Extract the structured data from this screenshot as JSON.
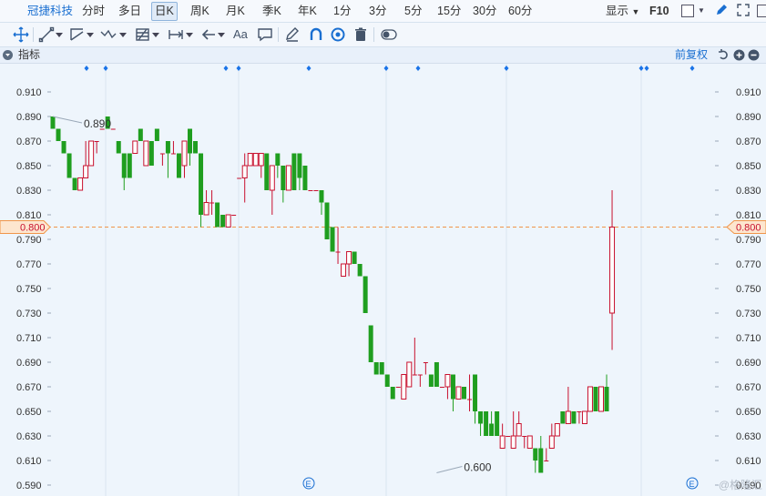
{
  "header": {
    "stock_name": "冠捷科技",
    "periods": [
      "分时",
      "多日",
      "日K",
      "周K",
      "月K",
      "季K",
      "年K",
      "1分",
      "3分",
      "5分",
      "15分",
      "30分",
      "60分"
    ],
    "active_period": "日K",
    "display_label": "显示",
    "f10_label": "F10"
  },
  "toolbar": {
    "text_tool_label": "Aa"
  },
  "indicator_bar": {
    "label": "指标",
    "adjust_label": "前复权"
  },
  "colors": {
    "up": "#c8102e",
    "down": "#1f9e1f",
    "accent": "#1a6fd1",
    "price_line": "#f0954a"
  },
  "chart_data": {
    "type": "candlestick",
    "ylim": [
      0.585,
      0.915
    ],
    "y_ticks": [
      "0.910",
      "0.890",
      "0.870",
      "0.850",
      "0.830",
      "0.810",
      "0.790",
      "0.770",
      "0.750",
      "0.730",
      "0.710",
      "0.690",
      "0.670",
      "0.650",
      "0.630",
      "0.610",
      "0.590"
    ],
    "current_price": "0.800",
    "annotations": [
      {
        "label": "0.890",
        "index": 0,
        "value": 0.89
      },
      {
        "label": "0.600",
        "index": 70,
        "value": 0.6
      }
    ],
    "event_badge": "E",
    "candles": [
      [
        0.89,
        0.88,
        0.89,
        0.88
      ],
      [
        0.88,
        0.87,
        0.88,
        0.87
      ],
      [
        0.87,
        0.86,
        0.87,
        0.86
      ],
      [
        0.86,
        0.84,
        0.86,
        0.84
      ],
      [
        0.84,
        0.83,
        0.84,
        0.83
      ],
      [
        0.83,
        0.84,
        0.84,
        0.83
      ],
      [
        0.84,
        0.85,
        0.87,
        0.84
      ],
      [
        0.85,
        0.87,
        0.87,
        0.85
      ],
      [
        0.87,
        0.87,
        0.87,
        0.86
      ],
      [
        0.88,
        0.88,
        0.88,
        0.88
      ],
      [
        0.89,
        0.88,
        0.89,
        0.88
      ],
      [
        0.88,
        0.88,
        0.88,
        0.88
      ],
      [
        0.87,
        0.86,
        0.87,
        0.86
      ],
      [
        0.86,
        0.84,
        0.86,
        0.83
      ],
      [
        0.86,
        0.84,
        0.86,
        0.84
      ],
      [
        0.86,
        0.87,
        0.87,
        0.86
      ],
      [
        0.88,
        0.87,
        0.88,
        0.87
      ],
      [
        0.85,
        0.87,
        0.87,
        0.85
      ],
      [
        0.87,
        0.85,
        0.87,
        0.85
      ],
      [
        0.88,
        0.87,
        0.88,
        0.87
      ],
      [
        0.86,
        0.86,
        0.86,
        0.85
      ],
      [
        0.87,
        0.86,
        0.87,
        0.84
      ],
      [
        0.86,
        0.86,
        0.87,
        0.86
      ],
      [
        0.86,
        0.84,
        0.86,
        0.84
      ],
      [
        0.85,
        0.87,
        0.87,
        0.84
      ],
      [
        0.88,
        0.86,
        0.88,
        0.85
      ],
      [
        0.87,
        0.86,
        0.87,
        0.86
      ],
      [
        0.86,
        0.81,
        0.86,
        0.8
      ],
      [
        0.81,
        0.82,
        0.83,
        0.81
      ],
      [
        0.82,
        0.82,
        0.83,
        0.81
      ],
      [
        0.82,
        0.8,
        0.82,
        0.8
      ],
      [
        0.81,
        0.8,
        0.81,
        0.8
      ],
      [
        0.8,
        0.81,
        0.81,
        0.8
      ],
      [
        0.81,
        0.81,
        0.81,
        0.81
      ],
      [
        0.84,
        0.84,
        0.84,
        0.84
      ],
      [
        0.84,
        0.85,
        0.86,
        0.82
      ],
      [
        0.85,
        0.86,
        0.86,
        0.85
      ],
      [
        0.85,
        0.86,
        0.86,
        0.85
      ],
      [
        0.85,
        0.86,
        0.86,
        0.84
      ],
      [
        0.86,
        0.83,
        0.86,
        0.83
      ],
      [
        0.83,
        0.85,
        0.85,
        0.81
      ],
      [
        0.86,
        0.85,
        0.86,
        0.84
      ],
      [
        0.85,
        0.83,
        0.85,
        0.82
      ],
      [
        0.83,
        0.85,
        0.85,
        0.83
      ],
      [
        0.86,
        0.83,
        0.86,
        0.83
      ],
      [
        0.86,
        0.84,
        0.86,
        0.83
      ],
      [
        0.85,
        0.83,
        0.85,
        0.83
      ],
      [
        0.83,
        0.83,
        0.83,
        0.83
      ],
      [
        0.83,
        0.83,
        0.83,
        0.83
      ],
      [
        0.83,
        0.82,
        0.83,
        0.81
      ],
      [
        0.82,
        0.79,
        0.82,
        0.79
      ],
      [
        0.8,
        0.78,
        0.8,
        0.78
      ],
      [
        0.78,
        0.78,
        0.8,
        0.77
      ],
      [
        0.76,
        0.77,
        0.77,
        0.76
      ],
      [
        0.77,
        0.78,
        0.78,
        0.76
      ],
      [
        0.78,
        0.77,
        0.78,
        0.77
      ],
      [
        0.77,
        0.76,
        0.77,
        0.76
      ],
      [
        0.76,
        0.73,
        0.76,
        0.73
      ],
      [
        0.72,
        0.69,
        0.72,
        0.69
      ],
      [
        0.69,
        0.68,
        0.69,
        0.68
      ],
      [
        0.69,
        0.68,
        0.69,
        0.68
      ],
      [
        0.68,
        0.67,
        0.68,
        0.67
      ],
      [
        0.67,
        0.66,
        0.67,
        0.66
      ],
      [
        0.67,
        0.67,
        0.67,
        0.67
      ],
      [
        0.66,
        0.68,
        0.68,
        0.66
      ],
      [
        0.67,
        0.69,
        0.69,
        0.67
      ],
      [
        0.68,
        0.68,
        0.71,
        0.68
      ],
      [
        0.68,
        0.68,
        0.68,
        0.67
      ],
      [
        0.69,
        0.69,
        0.69,
        0.68
      ],
      [
        0.68,
        0.67,
        0.68,
        0.67
      ],
      [
        0.69,
        0.67,
        0.69,
        0.67
      ],
      [
        0.67,
        0.67,
        0.67,
        0.67
      ],
      [
        0.67,
        0.68,
        0.68,
        0.66
      ],
      [
        0.68,
        0.66,
        0.68,
        0.65
      ],
      [
        0.66,
        0.67,
        0.67,
        0.66
      ],
      [
        0.67,
        0.66,
        0.67,
        0.66
      ],
      [
        0.66,
        0.66,
        0.68,
        0.65
      ],
      [
        0.68,
        0.65,
        0.68,
        0.64
      ],
      [
        0.65,
        0.64,
        0.65,
        0.63
      ],
      [
        0.65,
        0.63,
        0.65,
        0.63
      ],
      [
        0.64,
        0.63,
        0.65,
        0.63
      ],
      [
        0.65,
        0.63,
        0.65,
        0.63
      ],
      [
        0.62,
        0.63,
        0.64,
        0.62
      ],
      [
        0.63,
        0.63,
        0.63,
        0.63
      ],
      [
        0.62,
        0.63,
        0.65,
        0.62
      ],
      [
        0.63,
        0.64,
        0.65,
        0.63
      ],
      [
        0.63,
        0.63,
        0.63,
        0.62
      ],
      [
        0.62,
        0.63,
        0.63,
        0.62
      ],
      [
        0.62,
        0.61,
        0.62,
        0.6
      ],
      [
        0.62,
        0.6,
        0.63,
        0.6
      ],
      [
        0.61,
        0.61,
        0.62,
        0.61
      ],
      [
        0.62,
        0.63,
        0.64,
        0.62
      ],
      [
        0.63,
        0.64,
        0.64,
        0.63
      ],
      [
        0.65,
        0.64,
        0.65,
        0.64
      ],
      [
        0.64,
        0.65,
        0.67,
        0.64
      ],
      [
        0.65,
        0.64,
        0.65,
        0.64
      ],
      [
        0.65,
        0.65,
        0.65,
        0.64
      ],
      [
        0.64,
        0.65,
        0.65,
        0.64
      ],
      [
        0.65,
        0.67,
        0.67,
        0.65
      ],
      [
        0.67,
        0.65,
        0.67,
        0.65
      ],
      [
        0.65,
        0.67,
        0.67,
        0.65
      ],
      [
        0.67,
        0.65,
        0.68,
        0.65
      ],
      [
        0.73,
        0.8,
        0.83,
        0.7
      ]
    ]
  }
}
